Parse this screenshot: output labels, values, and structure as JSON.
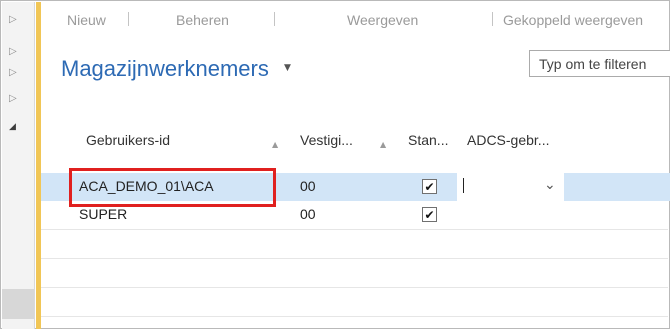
{
  "ribbon": {
    "tabs": [
      "Nieuw",
      "Beheren",
      "Weergeven",
      "Gekoppeld weergeven"
    ]
  },
  "page": {
    "title": "Magazijnwerknemers"
  },
  "filter": {
    "placeholder": "Typ om te filteren"
  },
  "columns": [
    "Gebruikers-id",
    "Vestigi...",
    "Stan...",
    "ADCS-gebr..."
  ],
  "rows": [
    {
      "user_id": "ACA_DEMO_01\\ACA",
      "location": "00",
      "default": true,
      "adcs_user": "",
      "selected": true
    },
    {
      "user_id": "SUPER",
      "location": "00",
      "default": true,
      "adcs_user": "",
      "selected": false
    }
  ],
  "icons": {
    "nav_expand": "triangle-right-icon",
    "nav_collapse": "triangle-down-icon",
    "title_menu": "chevron-down-icon",
    "sort": "sort-triangle-icon",
    "checkbox_checked": "checkmark-icon",
    "dropdown": "chevron-down-icon"
  },
  "colors": {
    "title": "#2d6ab4",
    "accent_bar": "#f1c656",
    "selected_row": "#d2e5f7",
    "highlight_box": "#e0201f"
  }
}
